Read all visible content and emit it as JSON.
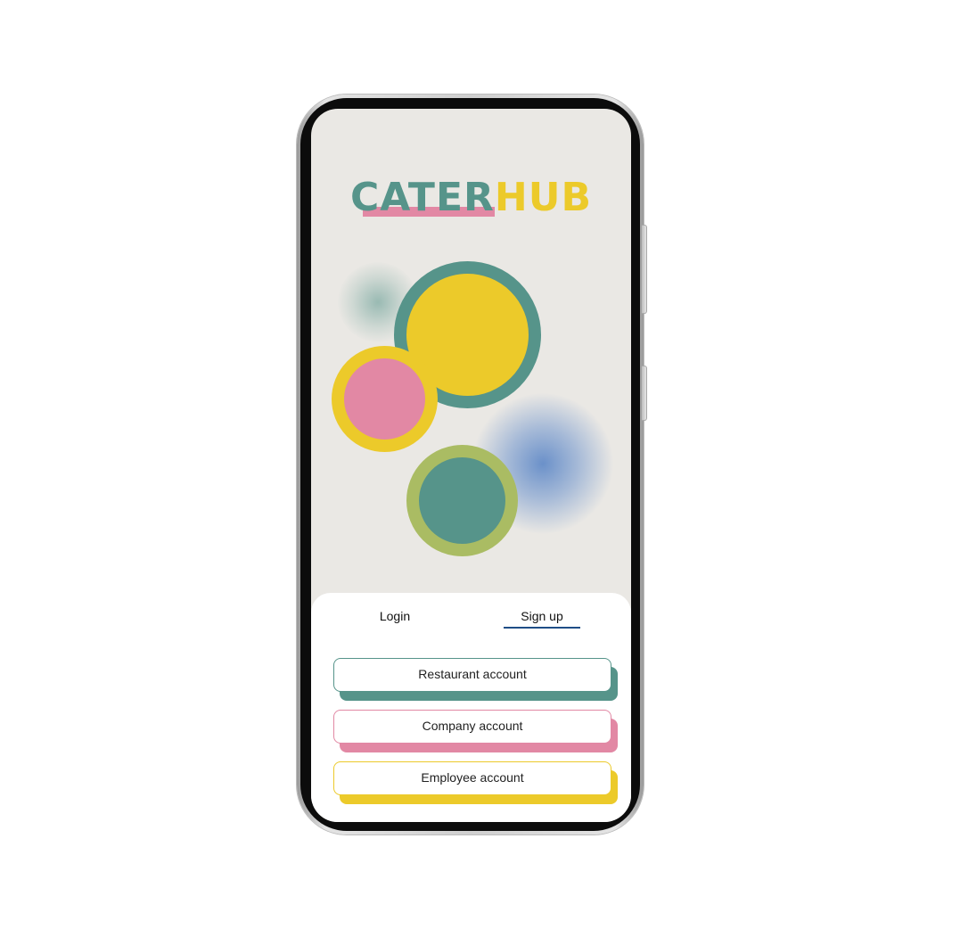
{
  "app": {
    "logo": {
      "part1": "CATER",
      "part2": "HUB"
    }
  },
  "colors": {
    "teal": "#56948a",
    "yellow": "#ecca2a",
    "pink": "#e288a4",
    "olive": "#aabc63",
    "blue_blur": "#6e94cd",
    "tab_underline": "#1f4e86",
    "screen_background": "#eae8e4"
  },
  "auth": {
    "tabs": [
      {
        "label": "Login",
        "active": false
      },
      {
        "label": "Sign up",
        "active": true
      }
    ],
    "account_types": [
      {
        "label": "Restaurant account",
        "accent": "#56948a"
      },
      {
        "label": "Company account",
        "accent": "#e288a4"
      },
      {
        "label": "Employee account",
        "accent": "#ecca2a"
      }
    ]
  }
}
